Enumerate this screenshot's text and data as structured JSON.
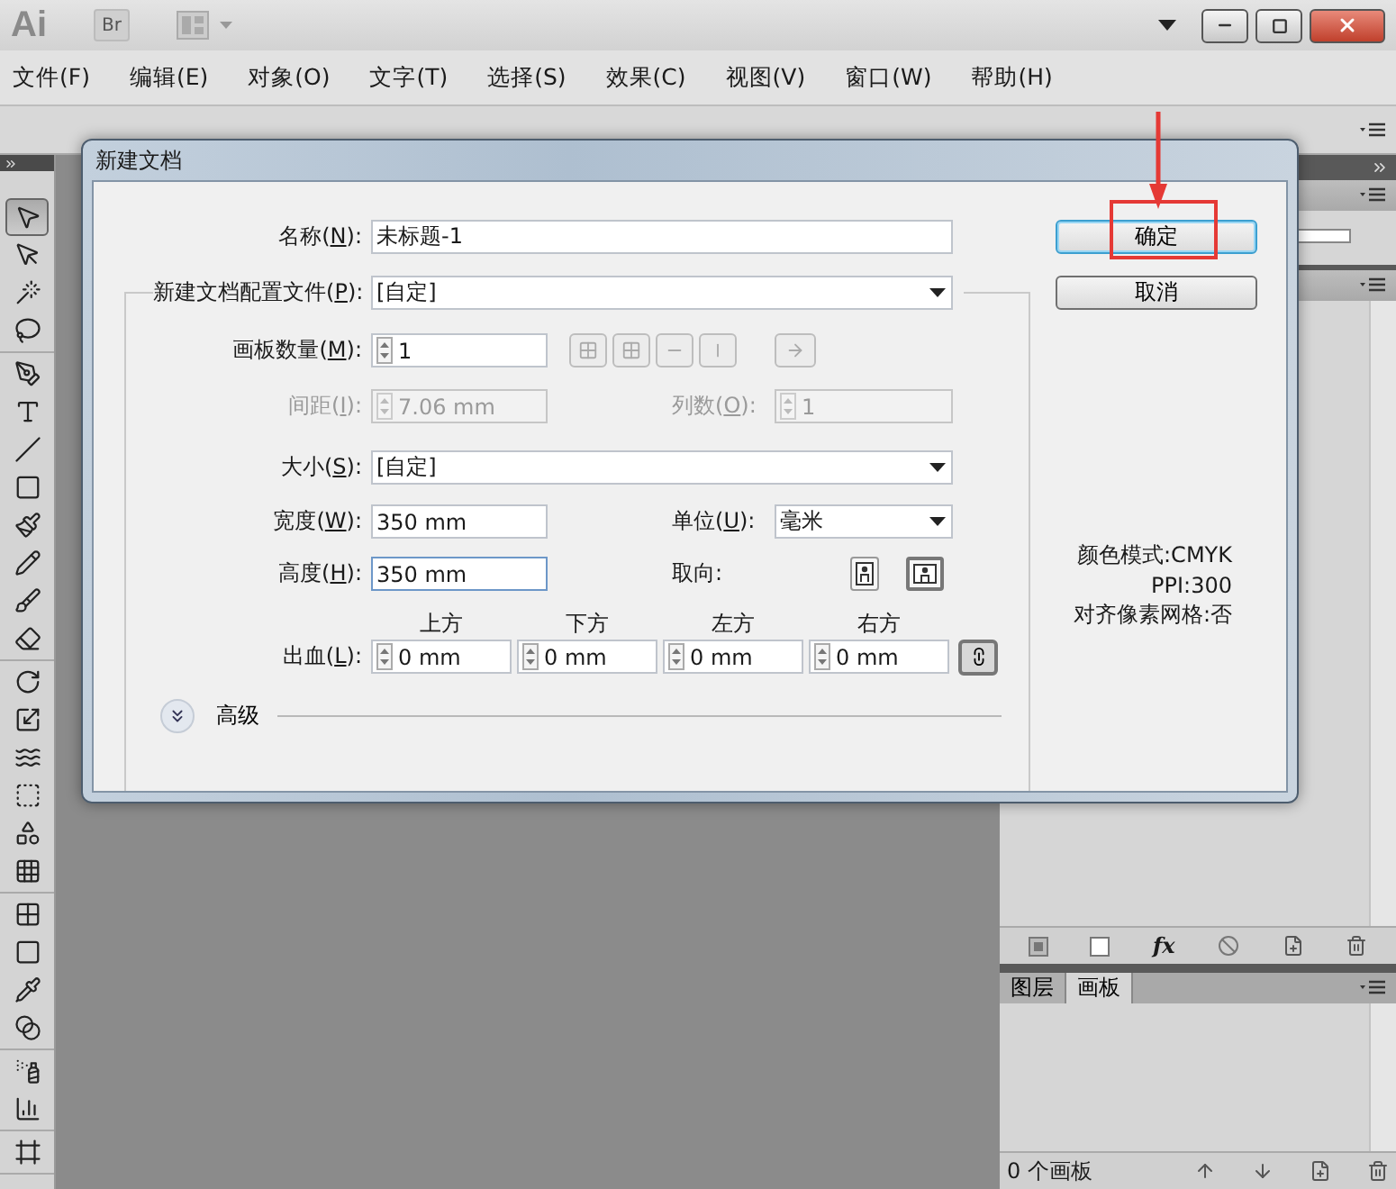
{
  "title_bar": {
    "logo": "Ai",
    "bridge": "Br"
  },
  "menu_bar": [
    "文件(F)",
    "编辑(E)",
    "对象(O)",
    "文字(T)",
    "选择(S)",
    "效果(C)",
    "视图(V)",
    "窗口(W)",
    "帮助(H)"
  ],
  "tool_groups": [
    [
      {
        "kind": "selection",
        "selected": true
      },
      {
        "kind": "direct-selection",
        "selected": false
      },
      {
        "kind": "magic-wand",
        "selected": false
      },
      {
        "kind": "lasso",
        "selected": false
      }
    ],
    [
      {
        "kind": "pen",
        "selected": false
      },
      {
        "kind": "type",
        "selected": false
      },
      {
        "kind": "line",
        "selected": false
      },
      {
        "kind": "rectangle",
        "selected": false
      },
      {
        "kind": "paintbrush",
        "selected": false
      },
      {
        "kind": "pencil",
        "selected": false
      },
      {
        "kind": "blob-brush",
        "selected": false
      },
      {
        "kind": "eraser",
        "selected": false
      }
    ],
    [
      {
        "kind": "rotate",
        "selected": false
      },
      {
        "kind": "scale",
        "selected": false
      },
      {
        "kind": "warp",
        "selected": false
      },
      {
        "kind": "free-transform",
        "selected": false
      },
      {
        "kind": "shape-builder",
        "selected": false
      },
      {
        "kind": "perspective-grid",
        "selected": false
      }
    ],
    [
      {
        "kind": "mesh",
        "selected": false
      },
      {
        "kind": "gradient",
        "selected": false
      },
      {
        "kind": "eyedropper",
        "selected": false
      },
      {
        "kind": "blend",
        "selected": false
      }
    ],
    [
      {
        "kind": "symbol-sprayer",
        "selected": false
      },
      {
        "kind": "column-graph",
        "selected": false
      }
    ],
    [
      {
        "kind": "artboard",
        "selected": false
      }
    ]
  ],
  "dialog": {
    "title": "新建文档",
    "name": {
      "label": [
        "名称(",
        "N",
        "):"
      ],
      "value": "未标题-1"
    },
    "profile": {
      "label": [
        "新建文档配置文件(",
        "P",
        "):"
      ],
      "value": "[自定]"
    },
    "artboards": {
      "label": [
        "画板数量(",
        "M",
        "):"
      ],
      "value": "1"
    },
    "spacing": {
      "label": [
        "间距(",
        "I",
        "):"
      ],
      "value": "7.06 mm",
      "disabled": true
    },
    "columns": {
      "label": [
        "列数(",
        "O",
        "):"
      ],
      "value": "1",
      "disabled": true
    },
    "size": {
      "label": [
        "大小(",
        "S",
        "):"
      ],
      "value": "[自定]"
    },
    "width": {
      "label": [
        "宽度(",
        "W",
        "):"
      ],
      "value": "350 mm"
    },
    "units": {
      "label": [
        "单位(",
        "U",
        "):"
      ],
      "value": "毫米"
    },
    "height": {
      "label": [
        "高度(",
        "H",
        "):"
      ],
      "value": "350 mm",
      "focused": true
    },
    "orientation": {
      "label": [
        "取向:"
      ],
      "options": [
        {
          "kind": "portrait",
          "selected": false
        },
        {
          "kind": "landscape",
          "selected": true
        }
      ]
    },
    "bleed": {
      "label": [
        "出血(",
        "L",
        "):"
      ],
      "sides": [
        {
          "heading": "上方",
          "value": "0 mm"
        },
        {
          "heading": "下方",
          "value": "0 mm"
        },
        {
          "heading": "左方",
          "value": "0 mm"
        },
        {
          "heading": "右方",
          "value": "0 mm"
        }
      ],
      "linked": true
    },
    "advanced": {
      "label": "高级",
      "expanded": false
    },
    "buttons": [
      {
        "label": "确定",
        "default": true
      },
      {
        "label": "取消",
        "default": false
      }
    ],
    "info": [
      "颜色模式:CMYK",
      "PPI:300",
      "对齐像素网格:否"
    ]
  },
  "layers_panel": {
    "effects_label": "fx"
  },
  "artboards_panel": {
    "tabs": [
      {
        "label": "图层",
        "selected": false
      },
      {
        "label": "画板",
        "selected": true
      }
    ],
    "count": "0 个画板"
  }
}
